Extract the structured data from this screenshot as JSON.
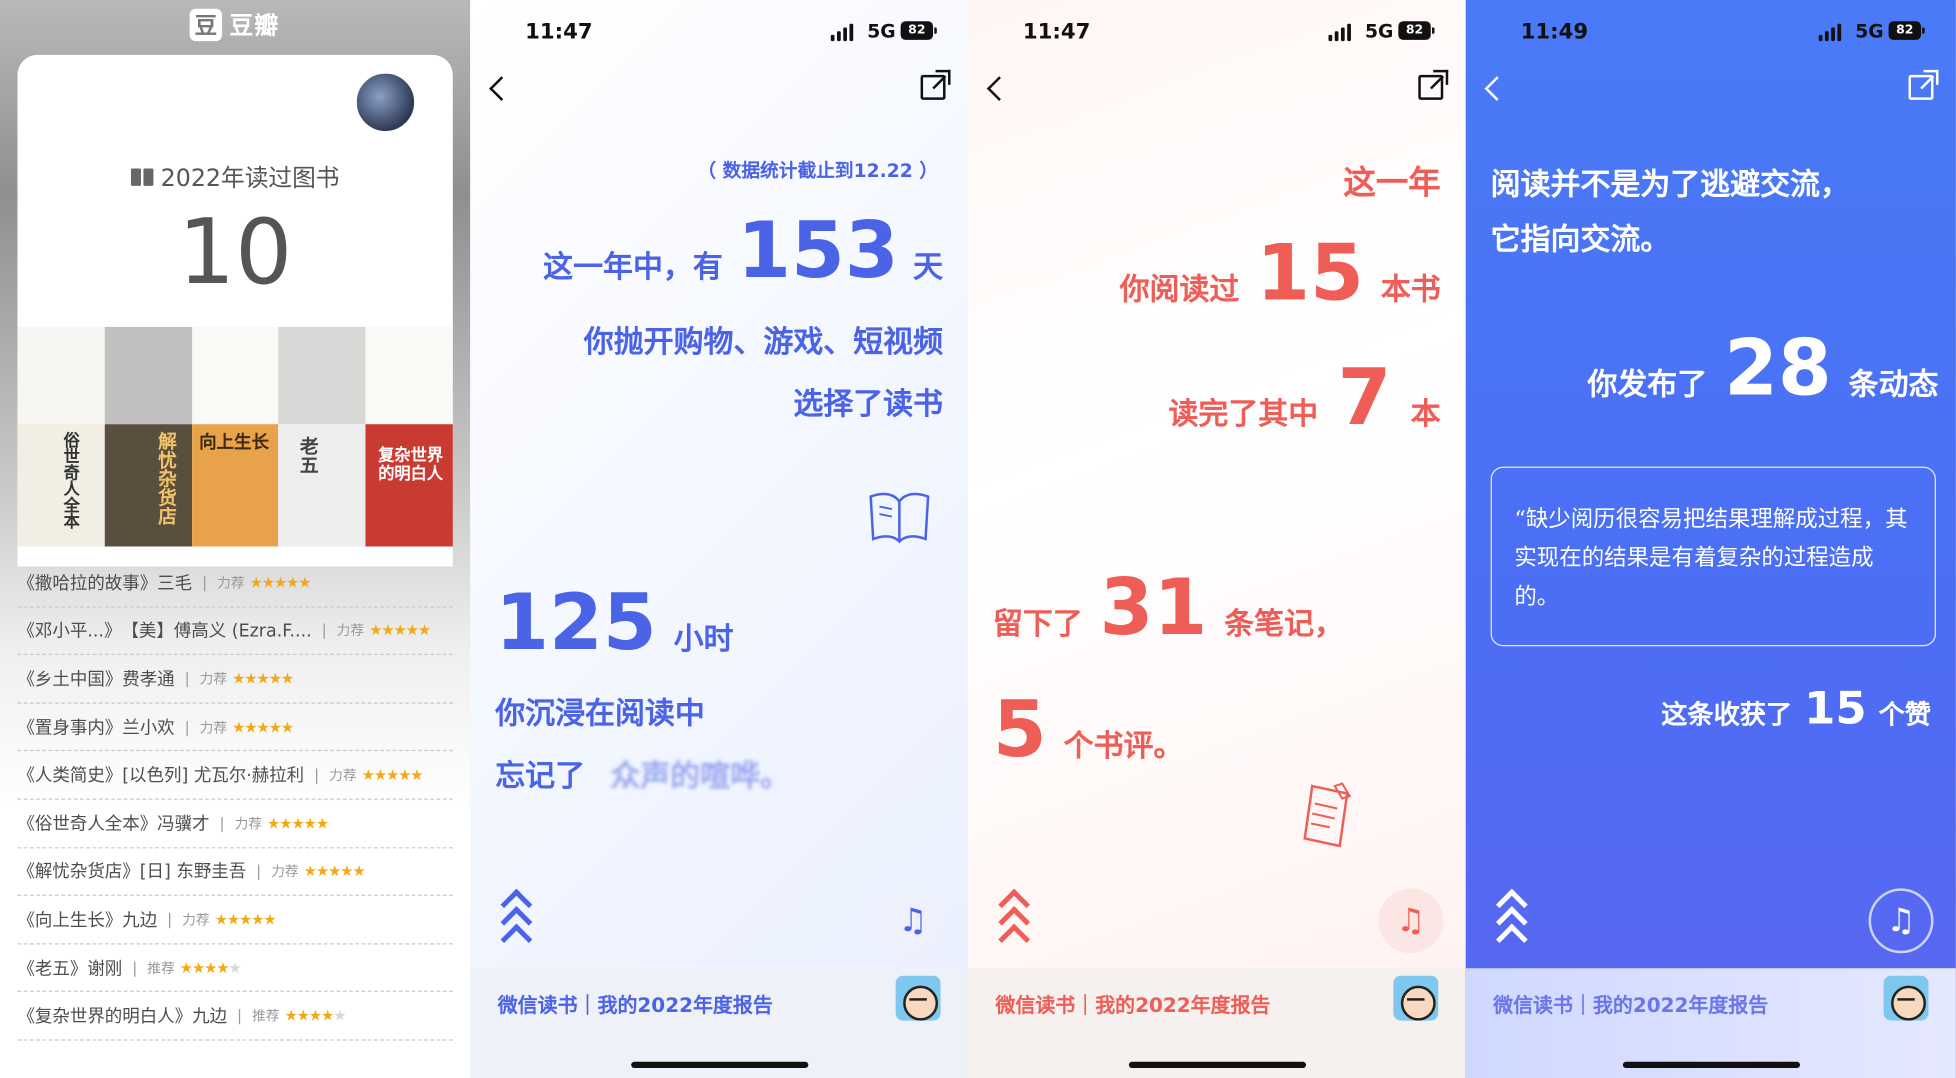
{
  "douban": {
    "app_name": "豆瓣",
    "badge": "豆",
    "year_label": "2022年读过图书",
    "count": "10",
    "covers": [
      {
        "title": "俗世奇人全本",
        "bg": "#f1eee4",
        "fg": "#333"
      },
      {
        "title": "解忧杂货店",
        "bg": "#5a4f3e",
        "fg": "#f0c36a"
      },
      {
        "title": "向上生长",
        "bg": "#e8a24a",
        "fg": "#3a2a10"
      },
      {
        "title": "老五",
        "bg": "#ededed",
        "fg": "#444"
      },
      {
        "title": "复杂世界的明白人",
        "bg": "#c93a33",
        "fg": "#ffffff"
      }
    ],
    "books": [
      {
        "title": "《撒哈拉的故事》",
        "author": "三毛",
        "tag": "力荐",
        "stars": 5
      },
      {
        "title": "《邓小平...》",
        "author": "【美】傅高义 (Ezra.F....",
        "tag": "力荐",
        "stars": 5
      },
      {
        "title": "《乡土中国》",
        "author": "费孝通",
        "tag": "力荐",
        "stars": 5
      },
      {
        "title": "《置身事内》",
        "author": "兰小欢",
        "tag": "力荐",
        "stars": 5
      },
      {
        "title": "《人类简史》",
        "author": "[以色列] 尤瓦尔·赫拉利",
        "tag": "力荐",
        "stars": 5
      },
      {
        "title": "《俗世奇人全本》",
        "author": "冯骥才",
        "tag": "力荐",
        "stars": 5
      },
      {
        "title": "《解忧杂货店》",
        "author": "[日] 东野圭吾",
        "tag": "力荐",
        "stars": 5
      },
      {
        "title": "《向上生长》",
        "author": "九边",
        "tag": "力荐",
        "stars": 5
      },
      {
        "title": "《老五》",
        "author": "谢刚",
        "tag": "推荐",
        "stars": 4
      },
      {
        "title": "《复杂世界的明白人》",
        "author": "九边",
        "tag": "推荐",
        "stars": 4
      }
    ]
  },
  "phone2": {
    "time": "11:47",
    "network": "5G",
    "battery": "82",
    "note": "（ 数据统计截止到12.22 ）",
    "line1_pre": "这一年中，有",
    "days": "153",
    "line1_unit": "天",
    "line2": "你抛开购物、游戏、短视频",
    "line3": "选择了读书",
    "hours": "125",
    "hours_unit": "小时",
    "line4": "你沉浸在阅读中",
    "line5_pre": "忘记了",
    "line5_blur": "众声的喧哗。",
    "footer": "微信读书｜我的2022年度报告",
    "music_icon": "♫",
    "accent": "#4b63e6"
  },
  "phone3": {
    "time": "11:47",
    "network": "5G",
    "battery": "82",
    "line1": "这一年",
    "line2_pre": "你阅读过",
    "books_read": "15",
    "line2_unit": "本书",
    "line3_pre": "读完了其中",
    "books_done": "7",
    "line3_unit": "本",
    "line4_pre": "留下了",
    "notes": "31",
    "line4_unit": "条笔记，",
    "reviews": "5",
    "line5_unit": "个书评。",
    "footer": "微信读书｜我的2022年度报告",
    "music_icon": "♫",
    "accent": "#ef5d57"
  },
  "phone4": {
    "time": "11:49",
    "network": "5G",
    "battery": "82",
    "line1": "阅读并不是为了逃避交流，",
    "line2": "它指向交流。",
    "line3_pre": "你发布了",
    "posts": "28",
    "line3_unit": "条动态",
    "quote": "“缺少阅历很容易把结果理解成过程，其实现在的结果是有着复杂的过程造成的。",
    "likes_pre": "这条收获了",
    "likes": "15",
    "likes_unit": "个赞",
    "footer": "微信读书｜我的2022年度报告",
    "music_icon": "♫"
  }
}
